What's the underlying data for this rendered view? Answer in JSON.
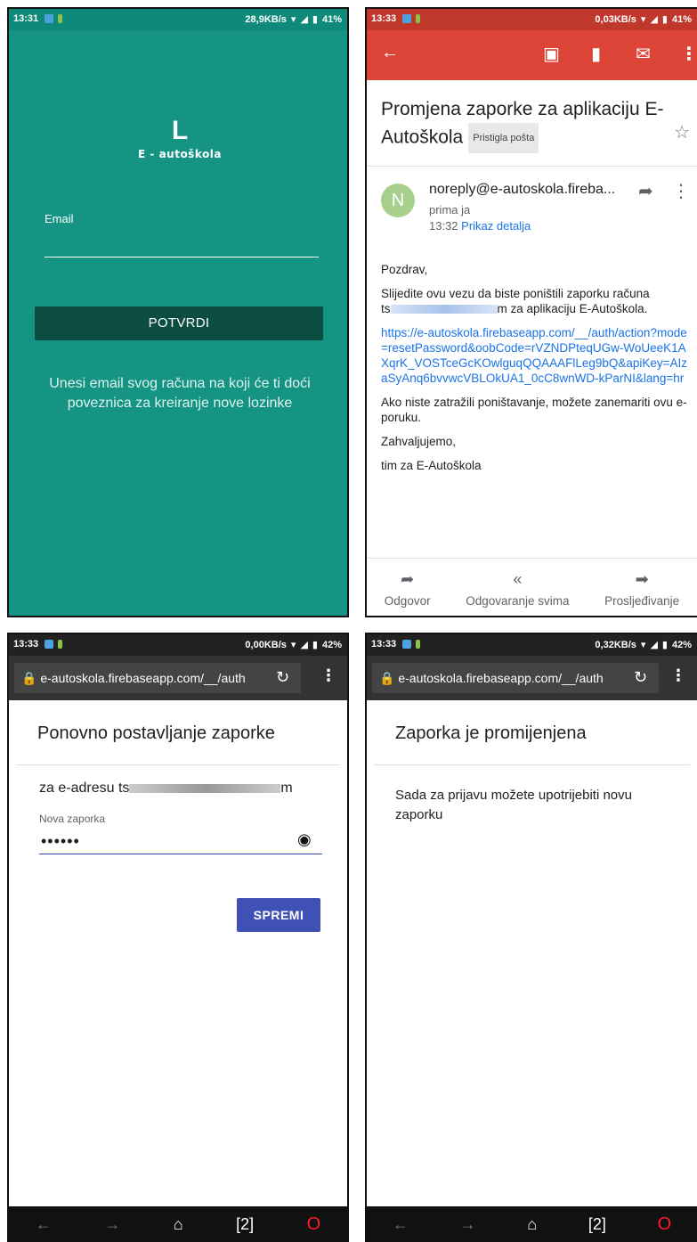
{
  "screen1": {
    "status": {
      "time": "13:31",
      "network": "28,9KB/s",
      "battery": "41%"
    },
    "logo": {
      "mark": "L",
      "name": "E - autoškola"
    },
    "email_label": "Email",
    "email_value": "",
    "confirm_label": "POTVRDI",
    "hint": "Unesi email svog računa na koji će ti doći poveznica za kreiranje nove lozinke"
  },
  "screen2": {
    "status": {
      "time": "13:33",
      "network": "0,03KB/s",
      "battery": "41%"
    },
    "subject": "Promjena zaporke za aplikaciju E-Autoškola",
    "label": "Pristigla pošta",
    "avatar_letter": "N",
    "sender": "noreply@e-autoskola.fireba...",
    "recipient": "prima ja",
    "time": "13:32",
    "details_link": "Prikaz detalja",
    "greeting": "Pozdrav,",
    "line1_start": "Slijedite ovu vezu da biste poništili zaporku računa",
    "line1_redacted_prefix": "ts",
    "line1_redacted_suffix": "m",
    "line1_end": " za aplikaciju E-Autoškola.",
    "url": "https://e-autoskola.firebaseapp.com/__/auth/action?mode=resetPassword&oobCode=rVZNDPteqUGw-WoUeeK1AXqrK_VOSTceGcKOwlguqQQAAAFlLeg9bQ&apiKey=AIzaSyAnq6bvvwcVBLOkUA1_0cC8wnWD-kParNI&lang=hr",
    "ignore_text": "Ako niste zatražili poništavanje, možete zanemariti ovu e-poruku.",
    "thanks": "Zahvaljujemo,",
    "signature": "tim za E-Autoškola",
    "actions": {
      "reply": "Odgovor",
      "reply_all": "Odgovaranje svima",
      "forward": "Prosljeđivanje"
    }
  },
  "screen3": {
    "status": {
      "time": "13:33",
      "network": "0,00KB/s",
      "battery": "42%"
    },
    "url": "e-autoskola.firebaseapp.com/__/auth",
    "title": "Ponovno postavljanje zaporke",
    "email_prefix": "za e-adresu ",
    "email_redacted_start": "ts",
    "email_redacted_end": "m",
    "password_label": "Nova zaporka",
    "password_value": "••••••",
    "save_label": "SPREMI",
    "tabs_count": "2"
  },
  "screen4": {
    "status": {
      "time": "13:33",
      "network": "0,32KB/s",
      "battery": "42%"
    },
    "url": "e-autoskola.firebaseapp.com/__/auth",
    "title": "Zaporka je promijenjena",
    "message": "Sada za prijavu možete upotrijebiti novu zaporku",
    "tabs_count": "2"
  },
  "colors": {
    "teal": "#159383",
    "gmail_red": "#db4437",
    "button_dark": "#0b4d40",
    "save_blue": "#3f51b5",
    "link_blue": "#1a73e8"
  },
  "icons": [
    "back-arrow-icon",
    "archive-icon",
    "delete-icon",
    "mail-icon",
    "more-vert-icon",
    "star-icon",
    "reply-icon",
    "reply-all-icon",
    "forward-icon",
    "lock-icon",
    "refresh-icon",
    "eye-icon",
    "home-icon",
    "tabs-icon",
    "opera-icon"
  ]
}
